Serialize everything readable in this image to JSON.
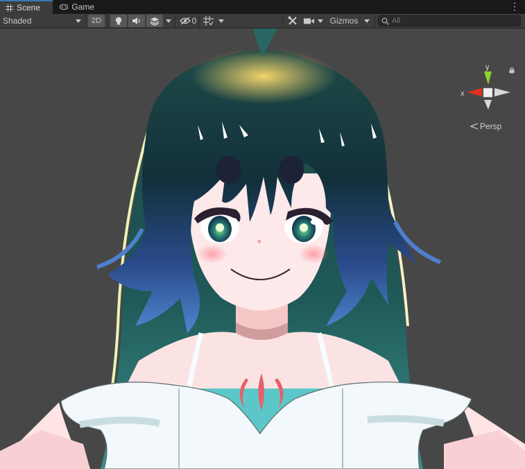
{
  "tabs": [
    {
      "label": "Scene",
      "icon": "grid-icon",
      "active": true
    },
    {
      "label": "Game",
      "icon": "gamepad-icon",
      "active": false
    }
  ],
  "toolbar": {
    "draw_mode": "Shaded",
    "mode_2d": "2D",
    "hidden_count": "0",
    "gizmos_label": "Gizmos",
    "search_placeholder": "All"
  },
  "orientation_gizmo": {
    "y_label": "y",
    "x_label": "x",
    "projection": "Persp"
  },
  "colors": {
    "tab_bar": "#191919",
    "toolbar": "#3c3c3c",
    "viewport": "#474747",
    "active_tab_accent": "#3a79bb",
    "axis_x": "#e0321f",
    "axis_y": "#8bd32b"
  }
}
